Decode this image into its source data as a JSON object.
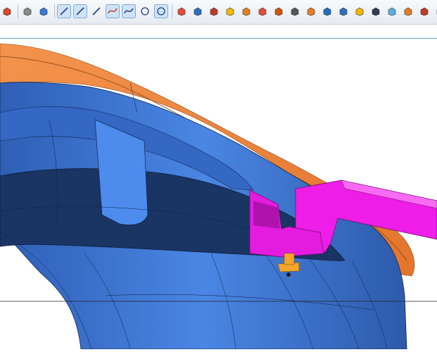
{
  "toolbar": {
    "tools": [
      {
        "name": "cut-face-icon",
        "color": "#d9482b"
      },
      {
        "name": "solid-box-icon",
        "color": "#8a8a8a"
      },
      {
        "name": "blue-solid-icon",
        "color": "#3a7bd5"
      },
      {
        "name": "line-icon",
        "color": "#1f3d7a",
        "active": true
      },
      {
        "name": "line-2-icon",
        "color": "#1f3d7a",
        "active": true
      },
      {
        "name": "spline-icon",
        "color": "#1f3d7a"
      },
      {
        "name": "curve-red-icon",
        "color": "#c0392b",
        "active": true
      },
      {
        "name": "curve-blue-icon",
        "color": "#1f3d7a",
        "active": true
      },
      {
        "name": "point-icon",
        "color": "#1f3d7a"
      },
      {
        "name": "circle-point-icon",
        "color": "#1f3d7a",
        "active": true
      },
      {
        "name": "surface-icon",
        "color": "#e74c3c"
      },
      {
        "name": "layers-icon",
        "color": "#2c6fbf"
      },
      {
        "name": "box-red-icon",
        "color": "#c0392b"
      },
      {
        "name": "extrude-icon",
        "color": "#f5b700"
      },
      {
        "name": "revolve-icon",
        "color": "#e67e22"
      },
      {
        "name": "sweep-icon",
        "color": "#e74c3c"
      },
      {
        "name": "loft-icon",
        "color": "#d35400"
      },
      {
        "name": "transform-icon",
        "color": "#555555"
      },
      {
        "name": "pattern-icon",
        "color": "#e67e22"
      },
      {
        "name": "draft-icon",
        "color": "#1f6fbf"
      },
      {
        "name": "shell-icon",
        "color": "#2c6fbf"
      },
      {
        "name": "fillet-icon",
        "color": "#f5b700"
      },
      {
        "name": "chamfer-icon",
        "color": "#2c3e50"
      },
      {
        "name": "boolean-icon",
        "color": "#5dade2"
      },
      {
        "name": "split-icon",
        "color": "#e67e22"
      },
      {
        "name": "trim-icon",
        "color": "#c0392b"
      },
      {
        "name": "offset-icon",
        "color": "#d35400"
      }
    ]
  },
  "viewport": {
    "colors": {
      "background": "#ffffff",
      "part_blue": "#3f77d6",
      "part_dark_blue": "#1a3464",
      "part_orange": "#f08640",
      "fixture_magenta": "#ee1ee8",
      "pin_orange": "#f5a52a"
    }
  }
}
